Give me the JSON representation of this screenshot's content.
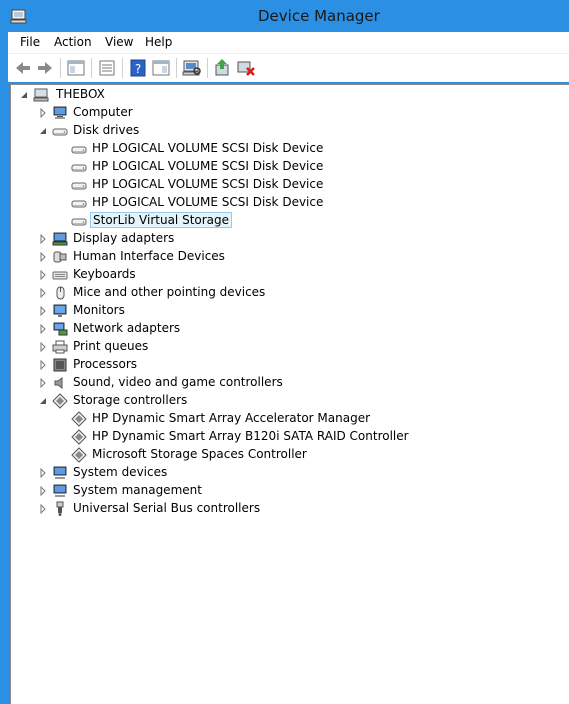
{
  "window": {
    "title": "Device Manager"
  },
  "menu": [
    "File",
    "Action",
    "View",
    "Help"
  ],
  "toolbar": {
    "buttons": [
      "back-icon",
      "forward-icon",
      "show-hide-tree-icon",
      "properties-icon",
      "help-icon",
      "action-pane-icon",
      "scan-hardware-icon",
      "update-driver-icon",
      "uninstall-icon"
    ]
  },
  "tree": {
    "root": "THEBOX",
    "items": [
      {
        "label": "Computer",
        "icon": "computer-icon",
        "expanded": false,
        "level": 1
      },
      {
        "label": "Disk drives",
        "icon": "disk-drive-icon",
        "expanded": true,
        "level": 1
      },
      {
        "label": "HP LOGICAL VOLUME SCSI Disk Device",
        "icon": "disk-drive-icon",
        "level": 2
      },
      {
        "label": "HP LOGICAL VOLUME SCSI Disk Device",
        "icon": "disk-drive-icon",
        "level": 2
      },
      {
        "label": "HP LOGICAL VOLUME SCSI Disk Device",
        "icon": "disk-drive-icon",
        "level": 2
      },
      {
        "label": "HP LOGICAL VOLUME SCSI Disk Device",
        "icon": "disk-drive-icon",
        "level": 2
      },
      {
        "label": "StorLib Virtual Storage",
        "icon": "disk-drive-icon",
        "level": 2,
        "selected": true
      },
      {
        "label": "Display adapters",
        "icon": "display-adapter-icon",
        "expanded": false,
        "level": 1
      },
      {
        "label": "Human Interface Devices",
        "icon": "hid-icon",
        "expanded": false,
        "level": 1
      },
      {
        "label": "Keyboards",
        "icon": "keyboard-icon",
        "expanded": false,
        "level": 1
      },
      {
        "label": "Mice and other pointing devices",
        "icon": "mouse-icon",
        "expanded": false,
        "level": 1
      },
      {
        "label": "Monitors",
        "icon": "monitor-icon",
        "expanded": false,
        "level": 1
      },
      {
        "label": "Network adapters",
        "icon": "network-adapter-icon",
        "expanded": false,
        "level": 1
      },
      {
        "label": "Print queues",
        "icon": "printer-icon",
        "expanded": false,
        "level": 1
      },
      {
        "label": "Processors",
        "icon": "processor-icon",
        "expanded": false,
        "level": 1
      },
      {
        "label": "Sound, video and game controllers",
        "icon": "speaker-icon",
        "expanded": false,
        "level": 1
      },
      {
        "label": "Storage controllers",
        "icon": "storage-controller-icon",
        "expanded": true,
        "level": 1
      },
      {
        "label": "HP Dynamic Smart Array Accelerator Manager",
        "icon": "storage-controller-icon",
        "level": 2
      },
      {
        "label": "HP Dynamic Smart Array B120i SATA RAID Controller",
        "icon": "storage-controller-icon",
        "level": 2
      },
      {
        "label": "Microsoft Storage Spaces Controller",
        "icon": "storage-controller-icon",
        "level": 2
      },
      {
        "label": "System devices",
        "icon": "system-devices-icon",
        "expanded": false,
        "level": 1
      },
      {
        "label": "System management",
        "icon": "system-devices-icon",
        "expanded": false,
        "level": 1
      },
      {
        "label": "Universal Serial Bus controllers",
        "icon": "usb-icon",
        "expanded": false,
        "level": 1
      }
    ]
  },
  "colors": {
    "titlebar": "#2b8fe3",
    "selection": "#e5f3fb",
    "selection_border": "#99c9ef"
  }
}
